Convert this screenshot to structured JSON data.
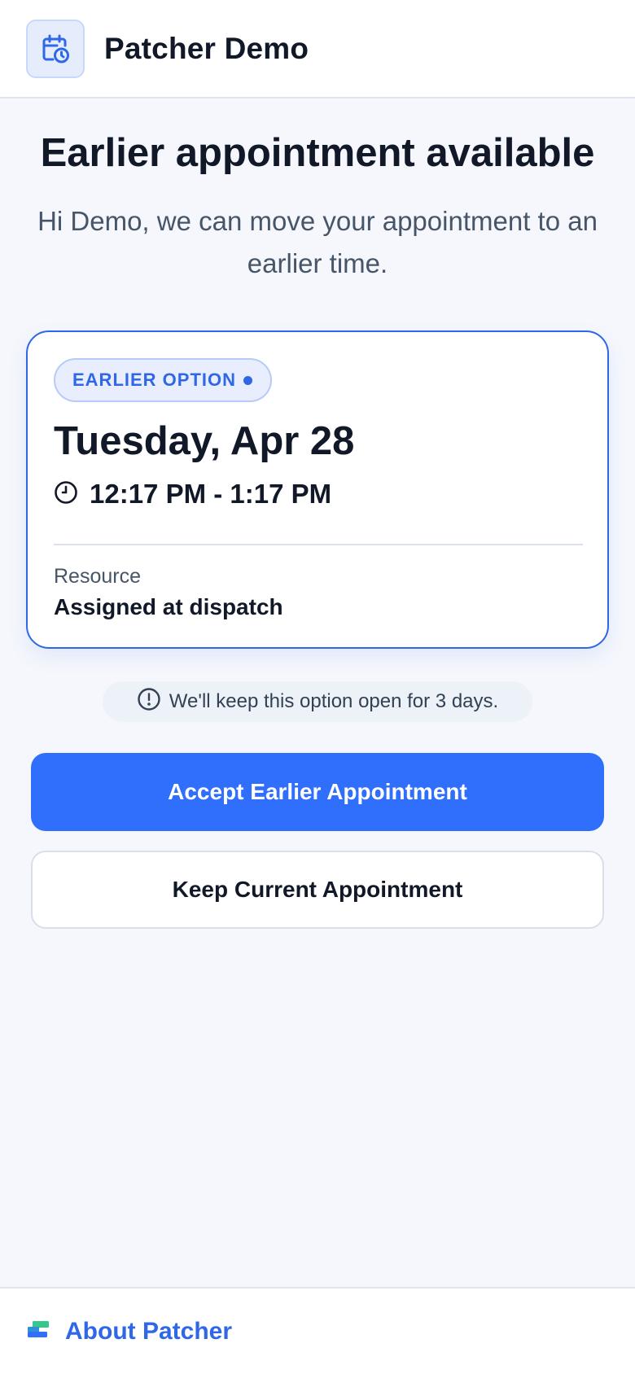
{
  "header": {
    "app_title": "Patcher Demo",
    "logo_icon": "calendar-clock-icon"
  },
  "main": {
    "title": "Earlier appointment available",
    "subtitle": "Hi Demo, we can move your appointment to an earlier time."
  },
  "card": {
    "badge": "EARLIER OPTION",
    "date": "Tuesday, Apr 28",
    "time_icon": "clock-icon",
    "time": "12:17 PM - 1:17 PM",
    "resource_label": "Resource",
    "resource_value": "Assigned at dispatch"
  },
  "notice": {
    "icon": "info-icon",
    "text": "We'll keep this option open for 3 days."
  },
  "actions": {
    "accept_label": "Accept Earlier Appointment",
    "keep_label": "Keep Current Appointment"
  },
  "footer": {
    "logo_icon": "patcher-logo-icon",
    "link_label": "About Patcher"
  },
  "colors": {
    "accent": "#2f6ffc",
    "brand_blue": "#2f67e6",
    "background": "#f5f7fc"
  }
}
